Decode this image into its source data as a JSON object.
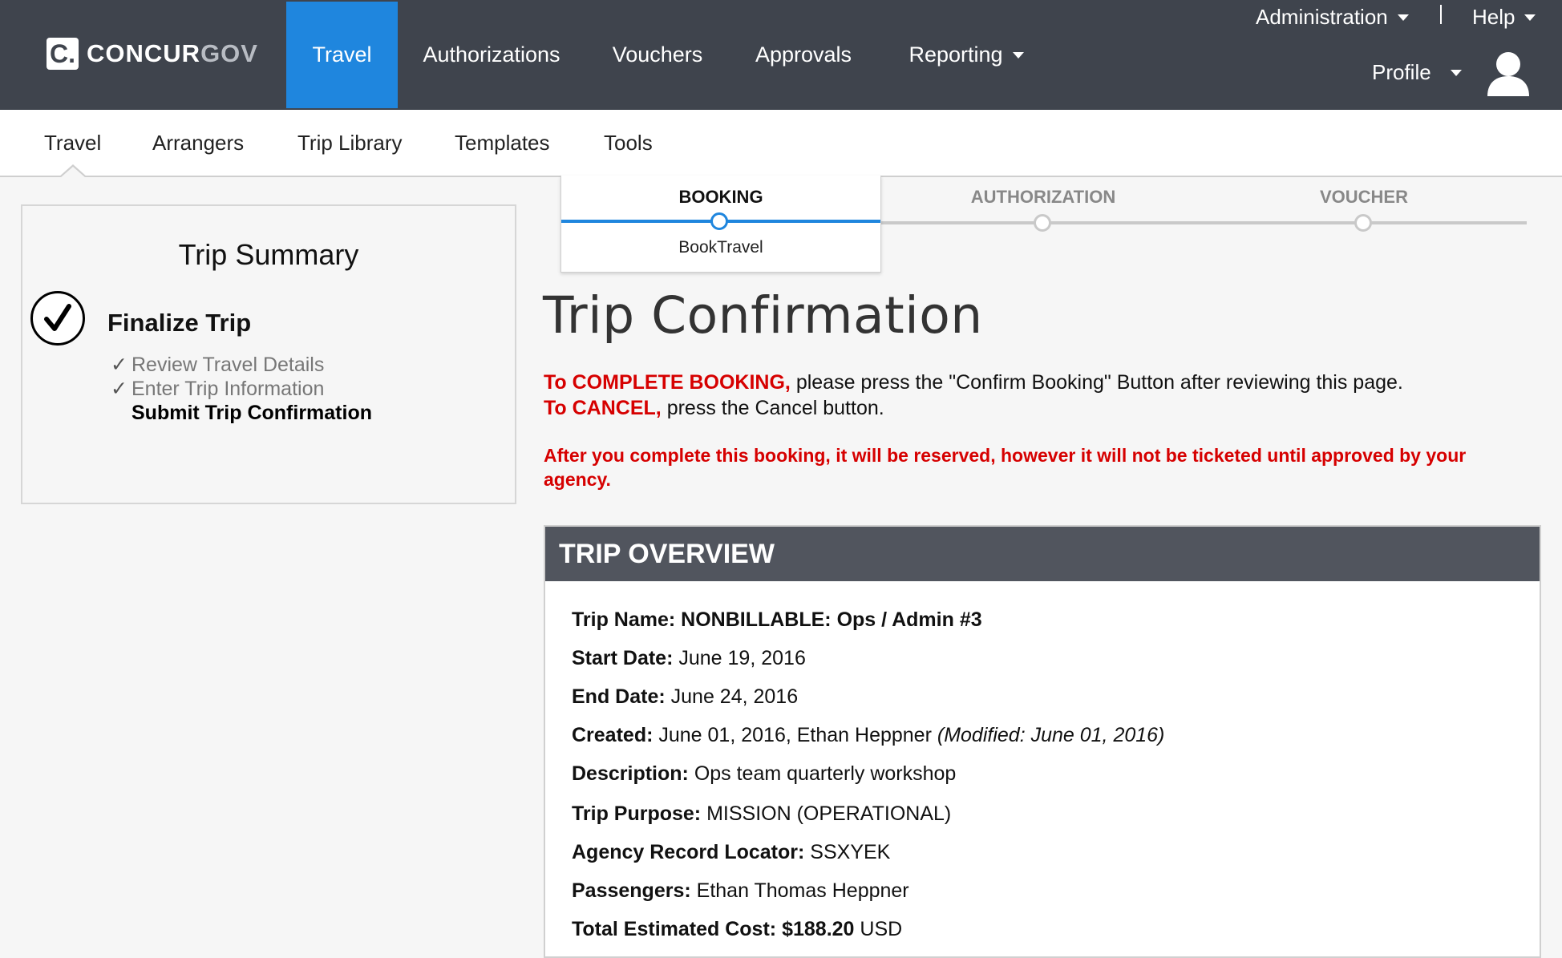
{
  "brand": {
    "logo_mark": "C.",
    "name_part1": "CONCUR",
    "name_part2": "GOV"
  },
  "main_nav": {
    "items": [
      {
        "label": "Travel",
        "active": true
      },
      {
        "label": "Authorizations"
      },
      {
        "label": "Vouchers"
      },
      {
        "label": "Approvals"
      },
      {
        "label": "Reporting",
        "has_dropdown": true
      }
    ]
  },
  "utility_nav": {
    "administration": "Administration",
    "help": "Help",
    "profile": "Profile",
    "avatar_icon": "user-silhouette-icon"
  },
  "sub_nav": {
    "items": [
      {
        "label": "Travel",
        "active": true
      },
      {
        "label": "Arrangers"
      },
      {
        "label": "Trip Library"
      },
      {
        "label": "Templates"
      },
      {
        "label": "Tools"
      }
    ]
  },
  "trip_summary": {
    "title": "Trip Summary",
    "stage": "Finalize Trip",
    "steps": [
      {
        "label": "Review Travel Details",
        "done": true
      },
      {
        "label": "Enter Trip Information",
        "done": true
      },
      {
        "label": "Submit Trip Confirmation",
        "current": true
      }
    ]
  },
  "progress": {
    "stages": [
      {
        "label": "BOOKING",
        "sub": "BookTravel",
        "active": true
      },
      {
        "label": "AUTHORIZATION"
      },
      {
        "label": "VOUCHER"
      }
    ]
  },
  "page": {
    "title": "Trip Confirmation",
    "instr1_red": "To COMPLETE BOOKING,",
    "instr1_rest": " please press the \"Confirm Booking\" Button after reviewing this page.",
    "instr2_red": "To CANCEL,",
    "instr2_rest": " press the Cancel button.",
    "warning": "After you complete this booking, it will be reserved, however it will not be ticketed until approved by your agency."
  },
  "overview": {
    "header": "TRIP OVERVIEW",
    "trip_name_label": "Trip Name:",
    "trip_name": "NONBILLABLE: Ops / Admin #3",
    "start_date_label": "Start Date:",
    "start_date": "June 19, 2016",
    "end_date_label": "End Date:",
    "end_date": "June 24, 2016",
    "created_label": "Created:",
    "created": "June 01, 2016, Ethan Heppner",
    "modified": "(Modified: June 01, 2016)",
    "description_label": "Description:",
    "description": "Ops team quarterly workshop",
    "purpose_label": "Trip Purpose:",
    "purpose": "MISSION (OPERATIONAL)",
    "locator_label": "Agency Record Locator:",
    "locator": "SSXYEK",
    "passengers_label": "Passengers:",
    "passengers": "Ethan Thomas Heppner",
    "cost_label": "Total Estimated Cost:",
    "cost_amount": "$188.20",
    "cost_currency": "USD"
  }
}
